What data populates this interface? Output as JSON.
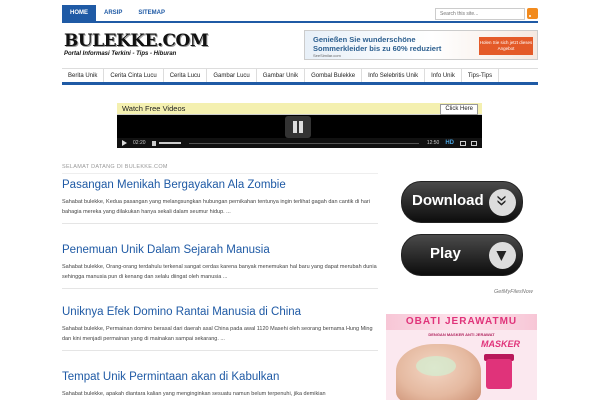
{
  "top_nav": {
    "items": [
      "HOME",
      "ARSIP",
      "SITEMAP"
    ],
    "search_placeholder": "Search this site..."
  },
  "logo": {
    "title": "BULEKKE.COM",
    "tagline": "Portal Informasi Terkini - Tips - Hiburan"
  },
  "header_ad": {
    "headline_1": "Genießen Sie wunderschöne",
    "headline_2": "Sommerkleider bis zu 60% reduziert",
    "source": "SeeSimilar.com",
    "button": "Holen Sie sich jetzt dieses Angebot"
  },
  "category_nav": {
    "items": [
      "Berita Unik",
      "Cerita Cinta Lucu",
      "Cerita Lucu",
      "Gambar Lucu",
      "Gambar Unik",
      "Gombal Bulekke",
      "Info Selebritis Unik",
      "Info Unik",
      "Tips-Tips"
    ]
  },
  "video_player": {
    "title": "Watch Free Videos",
    "cta": "Click Here",
    "elapsed": "02:20",
    "duration": "12:50",
    "quality": "HD"
  },
  "main": {
    "welcome": "SELAMAT DATANG DI BULEKKE.COM",
    "posts": [
      {
        "title": "Pasangan Menikah Bergayakan Ala Zombie",
        "excerpt": "Sahabat bulekke, Kedua pasangan yang melangsungkan hubungan pernikahan tentunya ingin terlihat gagah dan cantik di hari bahagia mereka yang dilakukan hanya sekali dalam seumur hidup. ..."
      },
      {
        "title": "Penemuan Unik Dalam Sejarah Manusia",
        "excerpt": "Sahabat bulekke, Orang-orang terdahulu terkenal sangat cerdas karena banyak menemukan hal baru yang dapat merubah dunia sehingga manusia pun di kenang dan selalu diingat oleh manusia ..."
      },
      {
        "title": "Uniknya Efek Domino Rantai Manusia di China",
        "excerpt": "Sahabat bulekke, Permainan domino berasal dari daerah asal China pada awal 1120 Masehi oleh seorang bernama Hung Ming  dan kini menjadi permainan yang di mainakan sampai sekarang. ..."
      },
      {
        "title": "Tempat Unik Permintaan akan di Kabulkan",
        "excerpt": "Sahabat bulekke, apakah diantara kalian yang menginginkan sesuatu namun belum terpenuhi, jika demikian"
      }
    ]
  },
  "sidebar": {
    "download_label": "Download",
    "play_label": "Play",
    "credit": "GetMyFilesNow",
    "ad": {
      "title": "OBATI JERAWATMU",
      "subtitle": "DENGAN MASKER ANTI JERAWAT",
      "brand": "MASKER"
    }
  },
  "colors": {
    "accent": "#1f5aa5",
    "rss": "#f28b1e",
    "ad_pink": "#e0337a"
  }
}
